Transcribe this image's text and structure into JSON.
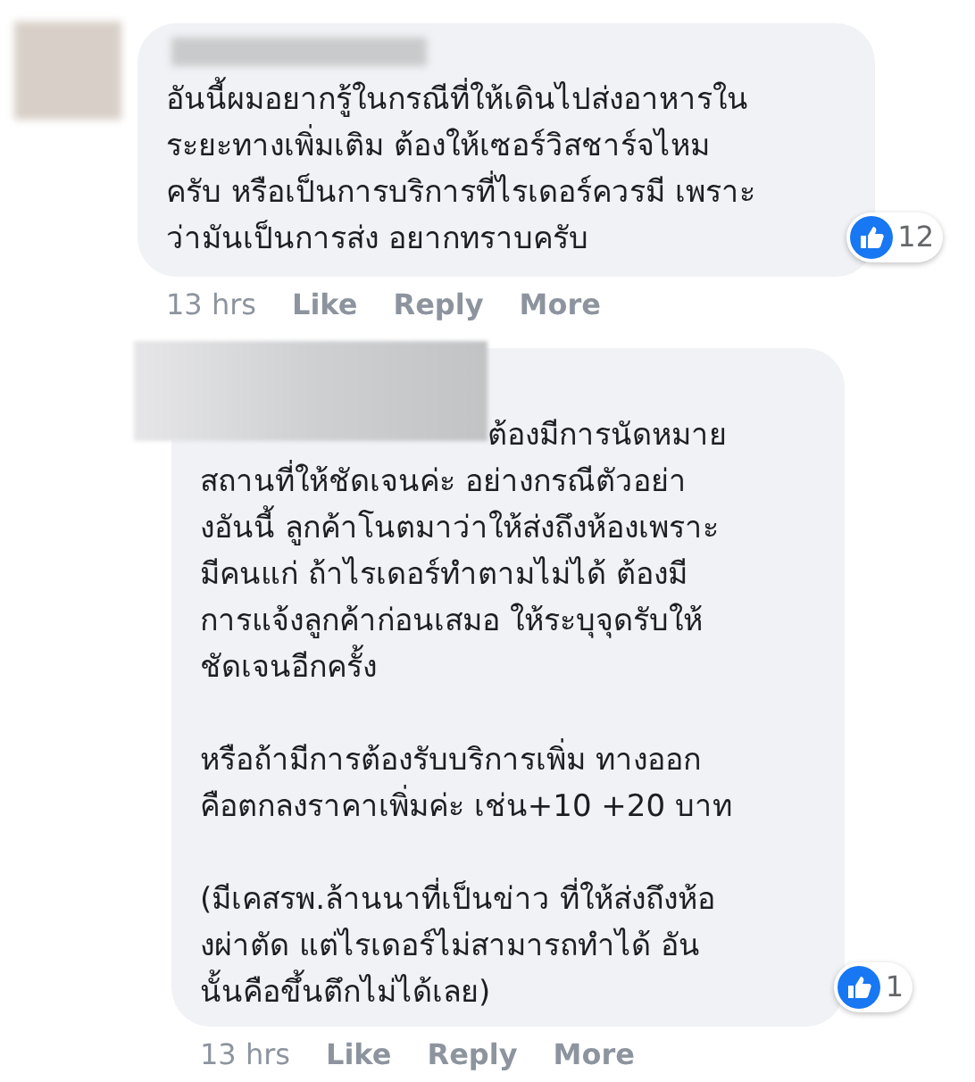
{
  "comments": [
    {
      "paragraphs": [
        {
          "lines": [
            "อันนี้ผมอยากรู้ในกรณีที่ให้เดินไปส่งอาหารใน",
            "ระยะทางเพิ่มเติม ต้องให้เซอร์วิสชาร์จไหม",
            "ครับ หรือเป็นการบริการที่ไรเดอร์ควรมี เพราะ",
            "ว่ามันเป็นการส่ง อยากทราบครับ"
          ]
        }
      ],
      "reactions": "12",
      "time": "13 hrs",
      "actions": [
        "Like",
        "Reply",
        "More"
      ]
    },
    {
      "paragraphs": [
        {
          "lines": [
            "ต้องมีการนัดหมาย",
            "สถานที่ให้ชัดเจนค่ะ อย่างกรณีตัวอย่า",
            "งอันนี้ ลูกค้าโนตมาว่าให้ส่งถึงห้องเพราะ",
            "มีคนแก่ ถ้าไรเดอร์ทำตามไม่ได้ ต้องมี",
            "การแจ้งลูกค้าก่อนเสมอ ให้ระบุจุดรับให้",
            "ชัดเจนอีกครั้ง"
          ]
        },
        {
          "lines": [
            "หรือถ้ามีการต้องรับบริการเพิ่ม ทางออก",
            "คือตกลงราคาเพิ่มค่ะ เช่น+10 +20 บาท"
          ]
        },
        {
          "lines": [
            "(มีเคสรพ.ล้านนาที่เป็นข่าว ที่ให้ส่งถึงห้อ",
            "งผ่าตัด แต่ไรเดอร์ไม่สามารถทำได้ อัน",
            "นั้นคือขึ้นตึกไม่ได้เลย)"
          ]
        }
      ],
      "reactions": "1",
      "time": "13 hrs",
      "actions": [
        "Like",
        "Reply",
        "More"
      ]
    }
  ]
}
